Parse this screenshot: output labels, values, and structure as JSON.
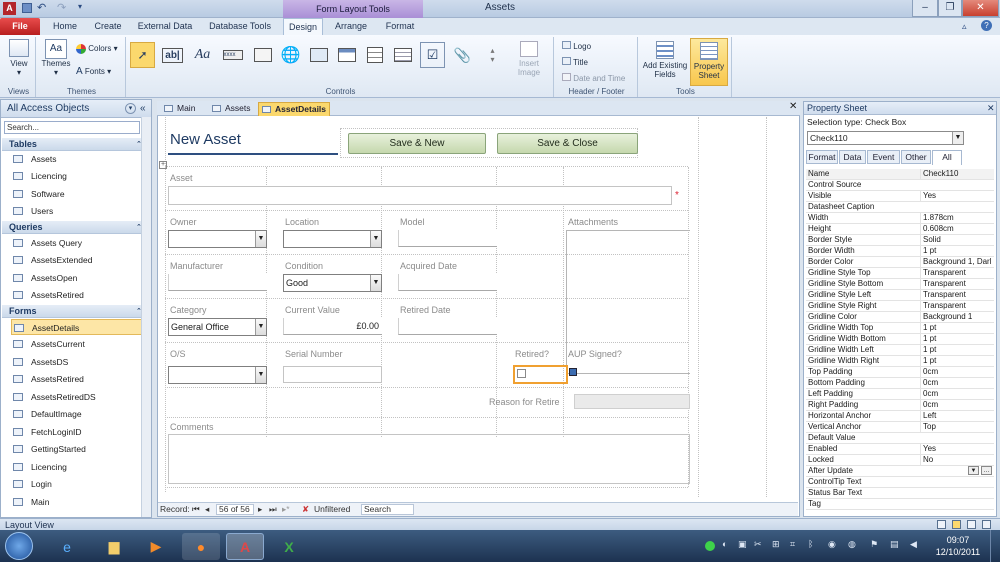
{
  "window": {
    "title": "Assets",
    "context_tab_group": "Form Layout Tools"
  },
  "ribbon_tabs": [
    "File",
    "Home",
    "Create",
    "External Data",
    "Database Tools",
    "Design",
    "Arrange",
    "Format"
  ],
  "ribbon": {
    "views": {
      "view_label": "View",
      "group": "Views"
    },
    "themes": {
      "themes_label": "Themes",
      "colors_label": "Colors",
      "fonts_label": "Fonts",
      "group": "Themes"
    },
    "controls": {
      "group": "Controls",
      "insert_image": "Insert Image"
    },
    "header_footer": {
      "logo": "Logo",
      "title": "Title",
      "date_time": "Date and Time",
      "group": "Header / Footer"
    },
    "tools": {
      "add_fields": "Add Existing Fields",
      "property_sheet": "Property Sheet",
      "group": "Tools"
    }
  },
  "nav": {
    "header": "All Access Objects",
    "search_placeholder": "Search...",
    "sections": [
      {
        "title": "Tables",
        "items": [
          "Assets",
          "Licencing",
          "Software",
          "Users"
        ]
      },
      {
        "title": "Queries",
        "items": [
          "Assets Query",
          "AssetsExtended",
          "AssetsOpen",
          "AssetsRetired"
        ]
      },
      {
        "title": "Forms",
        "items": [
          "AssetDetails",
          "AssetsCurrent",
          "AssetsDS",
          "AssetsRetired",
          "AssetsRetiredDS",
          "DefaultImage",
          "FetchLoginID",
          "GettingStarted",
          "Licencing",
          "Login",
          "Main"
        ]
      }
    ]
  },
  "doc_tabs": [
    "Main",
    "Assets",
    "AssetDetails"
  ],
  "form": {
    "title": "New Asset",
    "save_new": "Save & New",
    "save_close": "Save & Close",
    "labels": {
      "asset": "Asset",
      "owner": "Owner",
      "location": "Location",
      "model": "Model",
      "attachments": "Attachments",
      "manufacturer": "Manufacturer",
      "condition": "Condition",
      "acquired_date": "Acquired Date",
      "category": "Category",
      "current_value": "Current Value",
      "retired_date": "Retired Date",
      "os": "O/S",
      "serial_number": "Serial Number",
      "retired": "Retired?",
      "aup_signed": "AUP Signed?",
      "reason_for_retire": "Reason for Retire",
      "comments": "Comments"
    },
    "values": {
      "condition": "Good",
      "category": "General Office",
      "current_value": "£0.00"
    },
    "required_marker": "*"
  },
  "record_nav": {
    "label": "Record:",
    "position": "56 of 56",
    "filter": "Unfiltered",
    "search": "Search"
  },
  "property_sheet": {
    "title": "Property Sheet",
    "selection_type": "Selection type:  Check Box",
    "selected": "Check110",
    "tabs": [
      "Format",
      "Data",
      "Event",
      "Other",
      "All"
    ],
    "rows": [
      [
        "Name",
        "Check110"
      ],
      [
        "Control Source",
        ""
      ],
      [
        "Visible",
        "Yes"
      ],
      [
        "Datasheet Caption",
        ""
      ],
      [
        "Width",
        "1.878cm"
      ],
      [
        "Height",
        "0.608cm"
      ],
      [
        "Border Style",
        "Solid"
      ],
      [
        "Border Width",
        "1 pt"
      ],
      [
        "Border Color",
        "Background 1, Darl"
      ],
      [
        "Gridline Style Top",
        "Transparent"
      ],
      [
        "Gridline Style Bottom",
        "Transparent"
      ],
      [
        "Gridline Style Left",
        "Transparent"
      ],
      [
        "Gridline Style Right",
        "Transparent"
      ],
      [
        "Gridline Color",
        "Background 1"
      ],
      [
        "Gridline Width Top",
        "1 pt"
      ],
      [
        "Gridline Width Bottom",
        "1 pt"
      ],
      [
        "Gridline Width Left",
        "1 pt"
      ],
      [
        "Gridline Width Right",
        "1 pt"
      ],
      [
        "Top Padding",
        "0cm"
      ],
      [
        "Bottom Padding",
        "0cm"
      ],
      [
        "Left Padding",
        "0cm"
      ],
      [
        "Right Padding",
        "0cm"
      ],
      [
        "Horizontal Anchor",
        "Left"
      ],
      [
        "Vertical Anchor",
        "Top"
      ],
      [
        "Default Value",
        ""
      ],
      [
        "Enabled",
        "Yes"
      ],
      [
        "Locked",
        "No"
      ],
      [
        "After Update",
        ""
      ],
      [
        "ControlTip Text",
        ""
      ],
      [
        "Status Bar Text",
        ""
      ],
      [
        "Tag",
        ""
      ]
    ]
  },
  "statusbar": {
    "text": "Layout View"
  },
  "taskbar": {
    "time": "09:07",
    "date": "12/10/2011"
  },
  "colors": {
    "accent": "#fbd86d",
    "file_tab": "#c62828",
    "button_green": "#c5d8ad"
  }
}
